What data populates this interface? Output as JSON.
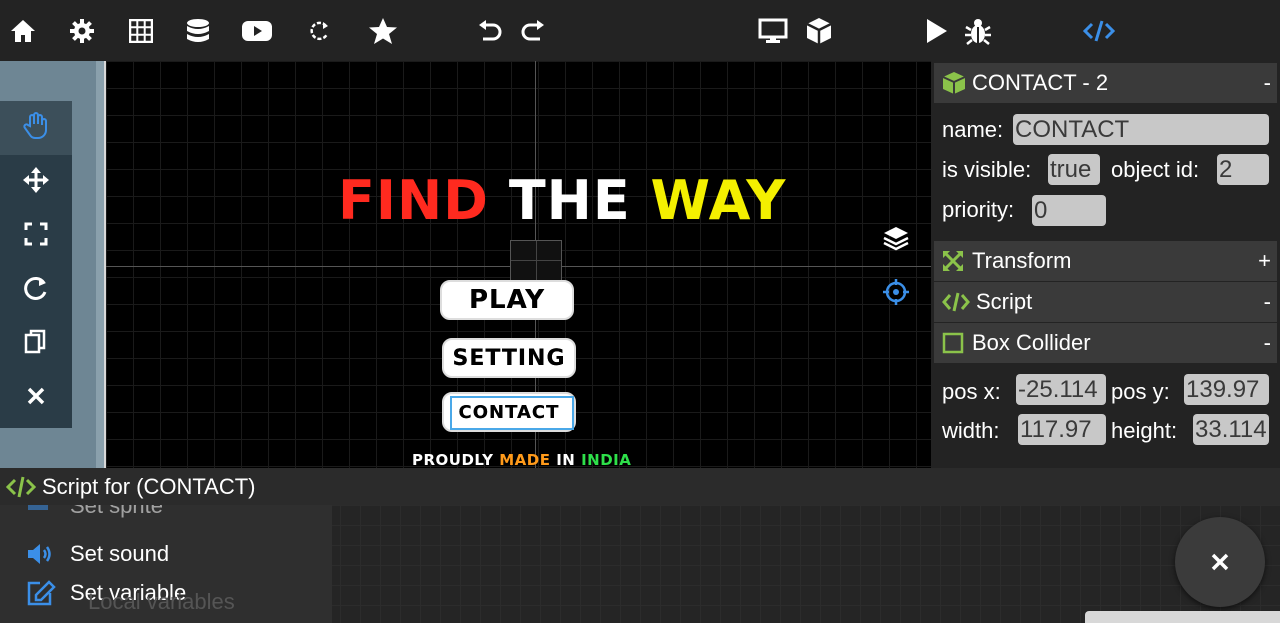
{
  "toolbar": {
    "icons": [
      "home-icon",
      "gear-icon",
      "grid-icon",
      "database-icon",
      "youtube-icon",
      "reload-icon",
      "star-icon",
      "undo-icon",
      "redo-icon",
      "monitor-icon",
      "cube-icon",
      "play-icon",
      "bug-icon",
      "code-icon"
    ],
    "accent": "#3b8fe8"
  },
  "tools": [
    "hand-icon",
    "move-icon",
    "scale-icon",
    "rotate-icon",
    "copy-icon",
    "delete-icon"
  ],
  "game": {
    "title_word1": "FIND",
    "title_word2": "THE",
    "title_word3": "WAY",
    "btn_play": "PLAY",
    "btn_setting": "SETTING",
    "btn_contact": "CONTACT",
    "credit_1": "PROUDLY",
    "credit_2": "MADE",
    "credit_3": "IN",
    "credit_4": "INDIA",
    "colors": {
      "red": "#ff2a1f",
      "white": "#ffffff",
      "yellow": "#f4f000",
      "orange": "#ff9a1a",
      "green": "#2ee04a"
    }
  },
  "inspector": {
    "object_header": "CONTACT - 2",
    "object_toggle": "-",
    "name_label": "name:",
    "name_value": "CONTACT",
    "visible_label": "is visible:",
    "visible_value": "true",
    "objid_label": "object id:",
    "objid_value": "2",
    "priority_label": "priority:",
    "priority_value": "0",
    "transform_label": "Transform",
    "transform_toggle": "+",
    "script_label": "Script",
    "script_toggle": "-",
    "collider_label": "Box Collider",
    "collider_toggle": "-",
    "posx_label": "pos x:",
    "posx_value": "-25.114",
    "posy_label": "pos y:",
    "posy_value": "139.97",
    "width_label": "width:",
    "width_value": "117.97",
    "height_label": "height:",
    "height_value": "33.114",
    "green": "#8bc34a"
  },
  "script_panel": {
    "title": "Script for (CONTACT)",
    "items": [
      "Set sprite",
      "Set sound",
      "Set variable"
    ],
    "ghost": "Local variables"
  }
}
